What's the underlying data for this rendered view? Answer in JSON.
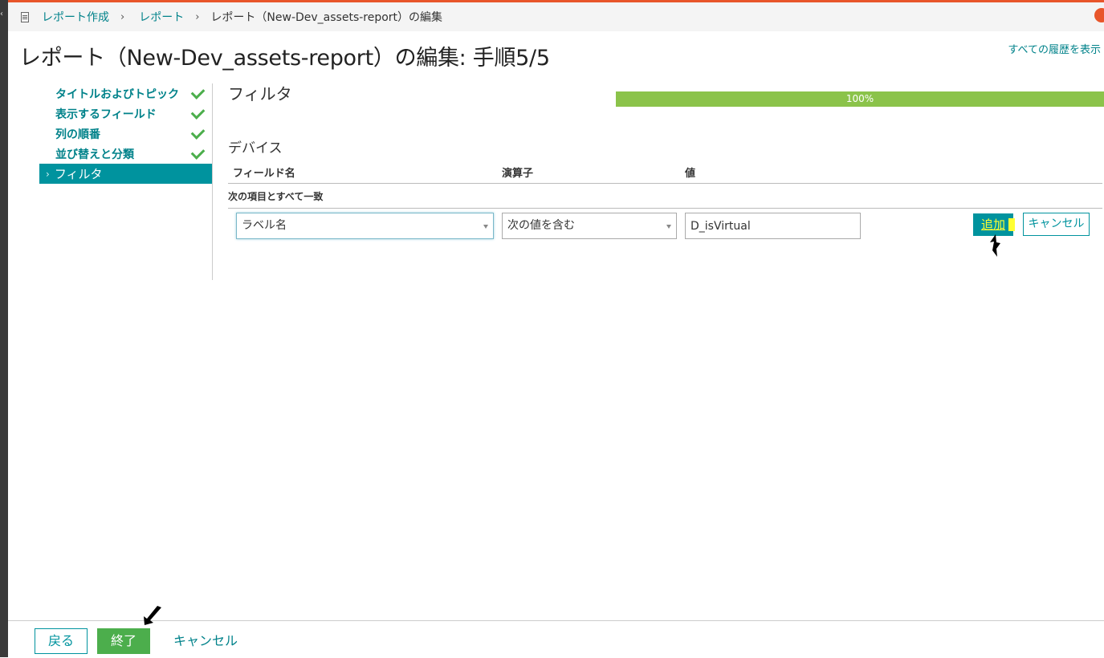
{
  "breadcrumb": {
    "items": [
      "レポート作成",
      "レポート"
    ],
    "separator": "›",
    "current": "レポート（New-Dev_assets-report）の編集"
  },
  "page": {
    "title": "レポート（New-Dev_assets-report）の編集: 手順5/5",
    "history_link": "すべての履歴を表示"
  },
  "steps": [
    {
      "label": "タイトルおよびトピック",
      "done": true
    },
    {
      "label": "表示するフィールド",
      "done": true
    },
    {
      "label": "列の順番",
      "done": true
    },
    {
      "label": "並び替えと分類",
      "done": true
    },
    {
      "label": "フィルタ",
      "active": true,
      "arrow": "›"
    }
  ],
  "section": {
    "title": "フィルタ",
    "progress_text": "100%",
    "progress_value": 100
  },
  "filter": {
    "group_label": "デバイス",
    "columns": {
      "field": "フィールド名",
      "operator": "演算子",
      "value": "値"
    },
    "match_label": "次の項目とすべて一致",
    "field_value": "ラベル名",
    "operator_value": "次の値を含む",
    "value_input": "D_isVirtual",
    "add_button": "追加",
    "cancel_button": "キャンセル"
  },
  "footer": {
    "back": "戻る",
    "finish": "終了",
    "cancel": "キャンセル"
  },
  "colors": {
    "accent": "#00939e",
    "link": "#00828a",
    "success": "#4cae4c",
    "progress": "#8bc34a",
    "highlight": "#ffff33",
    "top_bar": "#e8552a"
  }
}
